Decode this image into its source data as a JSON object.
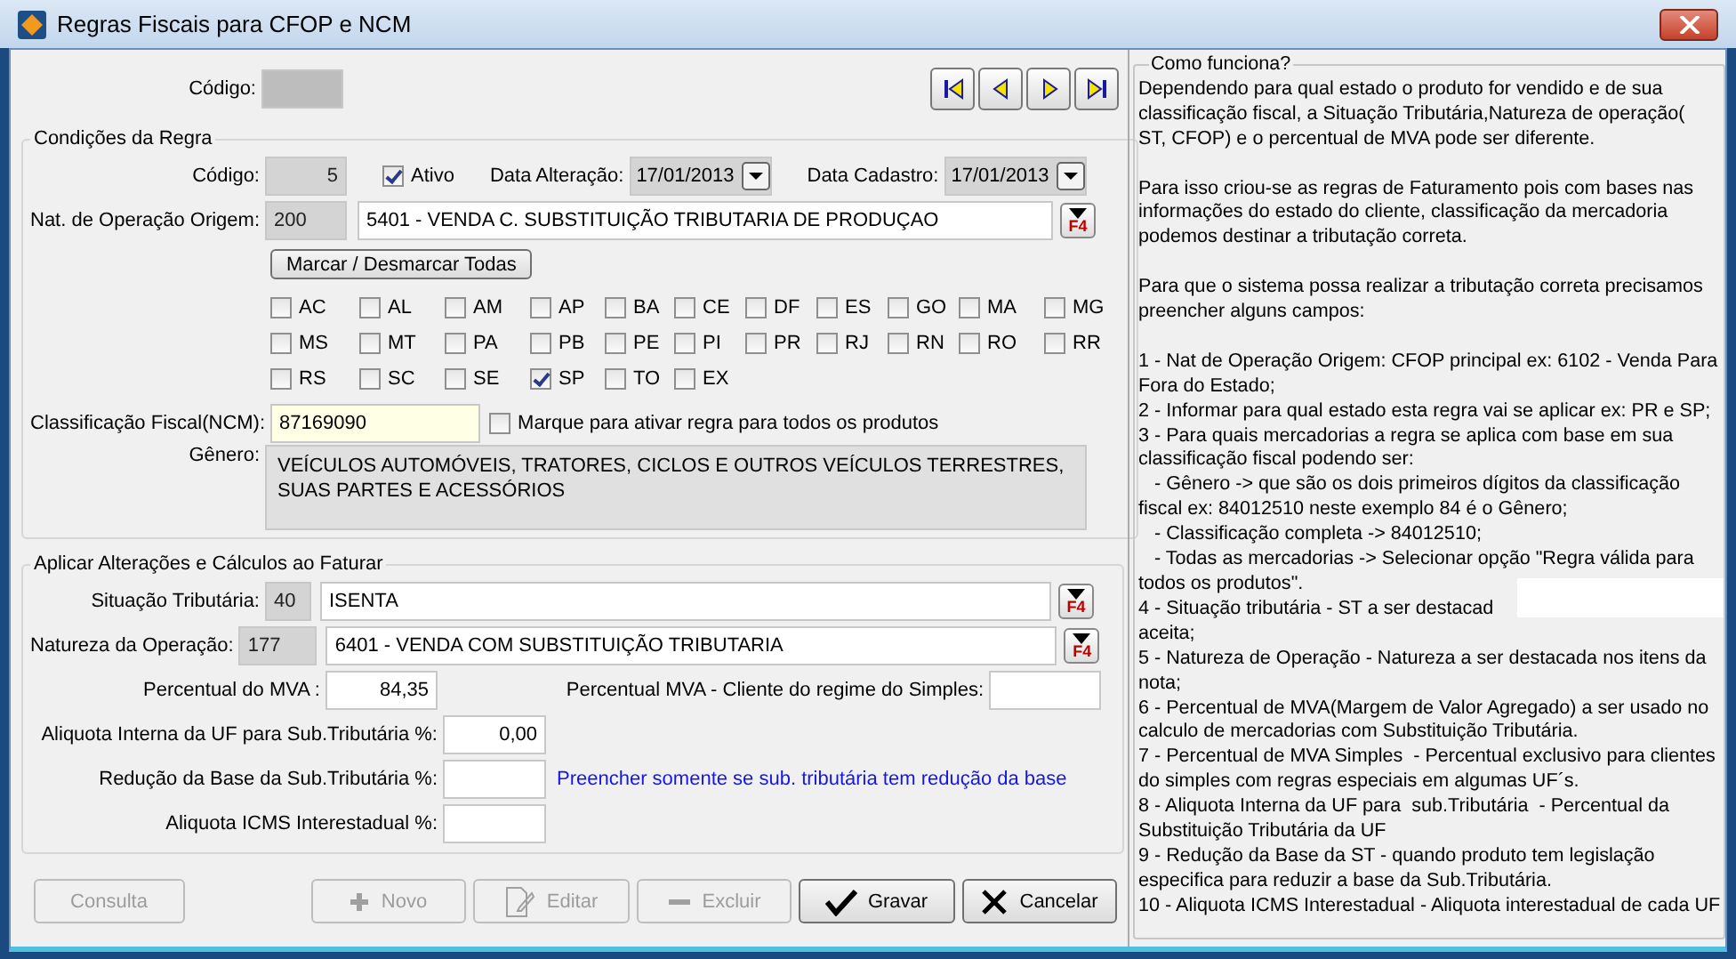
{
  "window": {
    "title": "Regras Fiscais para CFOP e NCM"
  },
  "top": {
    "codigo_label": "Código:"
  },
  "nav_buttons": [
    {
      "kind": "first"
    },
    {
      "kind": "prev"
    },
    {
      "kind": "next"
    },
    {
      "kind": "last"
    }
  ],
  "conditions": {
    "title": "Condições da Regra",
    "codigo_label": "Código:",
    "codigo_value": "5",
    "ativo": {
      "label": "Ativo",
      "checked": true
    },
    "data_alteracao": {
      "label": "Data Alteração:",
      "value": "17/01/2013"
    },
    "data_cadastro": {
      "label": "Data Cadastro:",
      "value": "17/01/2013"
    },
    "nat_origem": {
      "label": "Nat. de Operação Origem:",
      "code": "200",
      "value": "5401 - VENDA C. SUBSTITUIÇÃO TRIBUTARIA DE PRODUÇAO",
      "lookup": "F4"
    },
    "toggle_all": "Marcar / Desmarcar Todas",
    "states": [
      {
        "label": "AC",
        "checked": false
      },
      {
        "label": "AL",
        "checked": false
      },
      {
        "label": "AM",
        "checked": false
      },
      {
        "label": "AP",
        "checked": false
      },
      {
        "label": "BA",
        "checked": false
      },
      {
        "label": "CE",
        "checked": false
      },
      {
        "label": "DF",
        "checked": false
      },
      {
        "label": "ES",
        "checked": false
      },
      {
        "label": "GO",
        "checked": false
      },
      {
        "label": "MA",
        "checked": false
      },
      {
        "label": "MG",
        "checked": false
      },
      {
        "label": "MS",
        "checked": false
      },
      {
        "label": "MT",
        "checked": false
      },
      {
        "label": "PA",
        "checked": false
      },
      {
        "label": "PB",
        "checked": false
      },
      {
        "label": "PE",
        "checked": false
      },
      {
        "label": "PI",
        "checked": false
      },
      {
        "label": "PR",
        "checked": false
      },
      {
        "label": "RJ",
        "checked": false
      },
      {
        "label": "RN",
        "checked": false
      },
      {
        "label": "RO",
        "checked": false
      },
      {
        "label": "RR",
        "checked": false
      },
      {
        "label": "RS",
        "checked": false
      },
      {
        "label": "SC",
        "checked": false
      },
      {
        "label": "SE",
        "checked": false
      },
      {
        "label": "SP",
        "checked": true
      },
      {
        "label": "TO",
        "checked": false
      },
      {
        "label": "EX",
        "checked": false
      }
    ],
    "ncm": {
      "label": "Classificação Fiscal(NCM):",
      "value": "87169090"
    },
    "all_products": {
      "label": "Marque para ativar regra para todos os produtos",
      "checked": false
    },
    "genero": {
      "label": "Gênero:",
      "value": "VEÍCULOS AUTOMÓVEIS, TRATORES, CICLOS E OUTROS VEÍCULOS TERRESTRES, SUAS PARTES E ACESSÓRIOS"
    }
  },
  "apply": {
    "title": "Aplicar Alterações e Cálculos ao Faturar",
    "situacao": {
      "label": "Situação Tributária:",
      "code": "40",
      "value": "ISENTA",
      "lookup": "F4"
    },
    "natureza": {
      "label": "Natureza da Operação:",
      "code": "177",
      "value": "6401 - VENDA COM SUBSTITUIÇÃO TRIBUTARIA",
      "lookup": "F4"
    },
    "mva": {
      "label": "Percentual do MVA :",
      "value": "84,35"
    },
    "mva_simples": {
      "label": "Percentual MVA - Cliente do regime do Simples:"
    },
    "aliquota_interna": {
      "label": "Aliquota Interna da UF para Sub.Tributária %:",
      "value": "0,00"
    },
    "reducao": {
      "label": "Redução da Base da Sub.Tributária %:",
      "hint": "Preencher somente se sub. tributária tem redução da base"
    },
    "aliquota_icms": {
      "label": "Aliquota ICMS Interestadual %:"
    }
  },
  "buttons": [
    {
      "kind": "consulta",
      "label": "Consulta",
      "disabled": true
    },
    {
      "kind": "novo",
      "label": "Novo",
      "disabled": true
    },
    {
      "kind": "editar",
      "label": "Editar",
      "disabled": true
    },
    {
      "kind": "excluir",
      "label": "Excluir",
      "disabled": true
    },
    {
      "kind": "gravar",
      "label": "Gravar",
      "disabled": false
    },
    {
      "kind": "cancelar",
      "label": "Cancelar",
      "disabled": false
    }
  ],
  "help": {
    "title": "Como funciona?",
    "paragraphs": [
      [
        "Dependendo para qual estado o produto for vendido e de sua",
        "classificação fiscal, a Situação Tributária,Natureza de operação(",
        "ST, CFOP) e o percentual de MVA pode ser diferente."
      ],
      [
        "Para isso criou-se as regras de Faturamento pois com bases nas",
        "informações do estado do cliente, classificação da mercadoria",
        "podemos destinar a tributação correta."
      ],
      [
        "Para que o sistema possa realizar a tributação correta precisamos",
        "preencher alguns campos:"
      ],
      [
        "1 - Nat de Operação Origem: CFOP principal ex: 6102 - Venda Para",
        "Fora do Estado;",
        "2 - Informar para qual estado esta regra vai se aplicar ex: PR e SP;",
        "3 - Para quais mercadorias a regra se aplica com base em sua",
        "classificação fiscal podendo ser:",
        "   - Gênero -> que são os dois primeiros dígitos da classificação",
        "fiscal ex: 84012510 neste exemplo 84 é o Gênero;",
        "   - Classificação completa -> 84012510;",
        "   - Todas as mercadorias -> Selecionar opção \"Regra válida para",
        "todos os produtos\".",
        "4 - Situação tributária - ST a ser destacad",
        "aceita;",
        "5 - Natureza de Operação - Natureza a ser destacada nos itens da",
        "nota;",
        "6 - Percentual de MVA(Margem de Valor Agregado) a ser usado no",
        "calculo de mercadorias com Substituição Tributária.",
        "7 - Percentual de MVA Simples  - Percentual exclusivo para clientes",
        "do simples com regras especiais em algumas UF´s.",
        "8 - Aliquota Interna da UF para  sub.Tributária  - Percentual da",
        "Substituição Tributária da UF",
        "9 - Redução da Base da ST - quando produto tem legislação",
        "especifica para reduzir a base da Sub.Tributária.",
        "10 - Aliquota ICMS Interestadual - Aliquota interestadual de cada UF"
      ]
    ]
  }
}
